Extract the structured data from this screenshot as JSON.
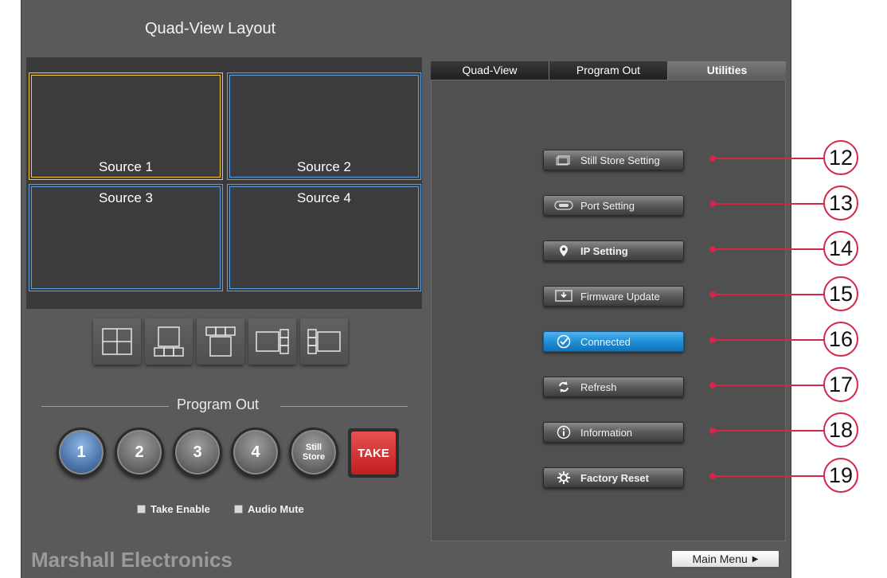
{
  "app": {
    "title": "Quad-View Layout",
    "brand": "Marshall Electronics"
  },
  "preview": {
    "cells": [
      {
        "label": "Source 1",
        "selected": true
      },
      {
        "label": "Source 2",
        "selected": false
      },
      {
        "label": "Source 3",
        "selected": false
      },
      {
        "label": "Source 4",
        "selected": false
      }
    ],
    "highlight_color": "#f5c542",
    "cell_border_color": "#5aa0e8"
  },
  "layouts": [
    {
      "icon": "quad-grid-layout-icon"
    },
    {
      "icon": "single-over-three-layout-icon"
    },
    {
      "icon": "three-over-single-layout-icon"
    },
    {
      "icon": "single-left-three-right-layout-icon"
    },
    {
      "icon": "three-left-single-right-layout-icon"
    }
  ],
  "program_out": {
    "title": "Program Out",
    "buttons": [
      {
        "label": "1",
        "active": true
      },
      {
        "label": "2",
        "active": false
      },
      {
        "label": "3",
        "active": false
      },
      {
        "label": "4",
        "active": false
      }
    ],
    "still_store_line1": "Still",
    "still_store_line2": "Store",
    "take_label": "TAKE",
    "take_enable_label": "Take Enable",
    "audio_mute_label": "Audio Mute"
  },
  "tabs": [
    {
      "label": "Quad-View",
      "active": false
    },
    {
      "label": "Program Out",
      "active": false
    },
    {
      "label": "Utilities",
      "active": true
    }
  ],
  "utilities": [
    {
      "label": "Still Store Setting",
      "icon": "still-store-icon",
      "callout": "12"
    },
    {
      "label": "Port Setting",
      "icon": "port-icon",
      "callout": "13"
    },
    {
      "label": "IP Setting",
      "icon": "location-pin-icon",
      "callout": "14"
    },
    {
      "label": "Firmware Update",
      "icon": "download-icon",
      "callout": "15"
    },
    {
      "label": "Connected",
      "icon": "checkmark-icon",
      "callout": "16",
      "status": "connected"
    },
    {
      "label": "Refresh",
      "icon": "refresh-icon",
      "callout": "17"
    },
    {
      "label": "Information",
      "icon": "info-icon",
      "callout": "18"
    },
    {
      "label": "Factory Reset",
      "icon": "gear-reset-icon",
      "callout": "19"
    }
  ],
  "main_menu_label": "Main Menu",
  "callout_color": "#d4264a",
  "connected_color": "#1f8fd6"
}
